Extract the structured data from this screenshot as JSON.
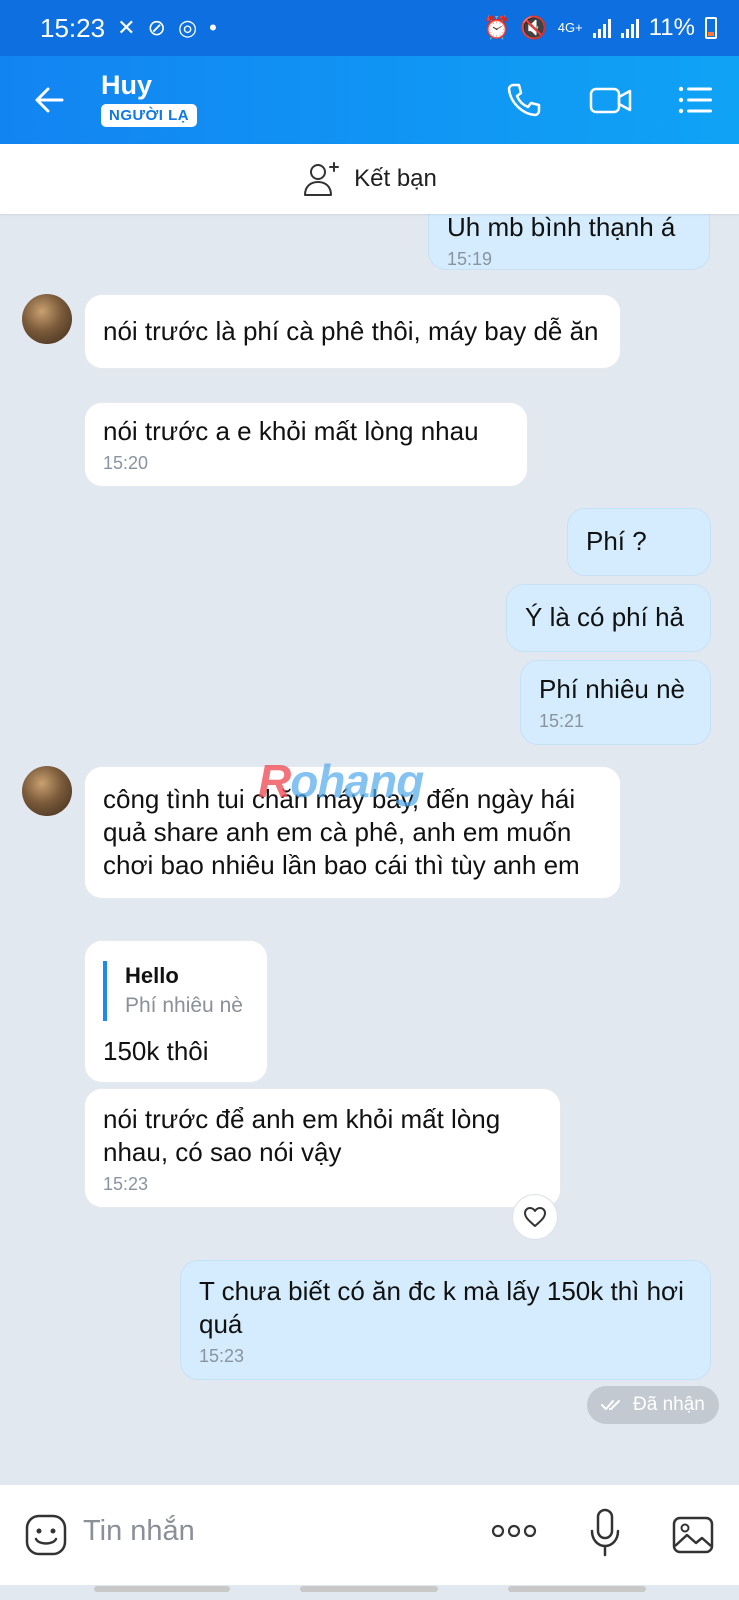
{
  "status_bar": {
    "time": "15:23",
    "network": "4G+",
    "battery": "11%"
  },
  "header": {
    "name": "Huy",
    "badge": "NGƯỜI LẠ"
  },
  "friend_bar": {
    "label": "Kết bạn"
  },
  "messages": [
    {
      "side": "out",
      "text": "Uh mb bình thạnh á",
      "time": "15:19"
    },
    {
      "side": "in",
      "text": "nói trước là phí cà phê thôi, máy bay dễ ăn"
    },
    {
      "side": "in",
      "text": "nói trước a e khỏi mất lòng nhau",
      "time": "15:20"
    },
    {
      "side": "out",
      "text": "Phí ?"
    },
    {
      "side": "out",
      "text": "Ý là có phí hả"
    },
    {
      "side": "out",
      "text": "Phí nhiêu nè",
      "time": "15:21"
    },
    {
      "side": "in",
      "text": "công tình tui chăn máy bay, đến ngày hái quả share anh em cà phê, anh em muốn chơi bao nhiêu lần bao cái thì tùy anh em"
    },
    {
      "side": "in",
      "reply_name": "Hello",
      "reply_text": "Phí nhiêu nè",
      "text": "150k thôi"
    },
    {
      "side": "in",
      "text": "nói trước để anh em khỏi mất lòng nhau, có sao nói vậy",
      "time": "15:23"
    },
    {
      "side": "out",
      "text": "T chưa biết có ăn đc k mà lấy 150k  thì hơi quá",
      "time": "15:23"
    }
  ],
  "received_label": "Đã nhận",
  "watermark": {
    "part1": "R",
    "part2": "ohang"
  },
  "input": {
    "placeholder": "Tin nhắn"
  },
  "colors": {
    "header_start": "#1284f2",
    "header_end": "#0fa3f5",
    "outgoing_bubble": "#d4ecfd",
    "incoming_bubble": "#ffffff",
    "chat_background": "#e2e8ef"
  },
  "icons": [
    "back-arrow-icon",
    "phone-icon",
    "video-call-icon",
    "menu-icon",
    "add-friend-icon",
    "heart-icon",
    "sticker-icon",
    "more-icon",
    "microphone-icon",
    "image-icon",
    "double-check-icon"
  ]
}
